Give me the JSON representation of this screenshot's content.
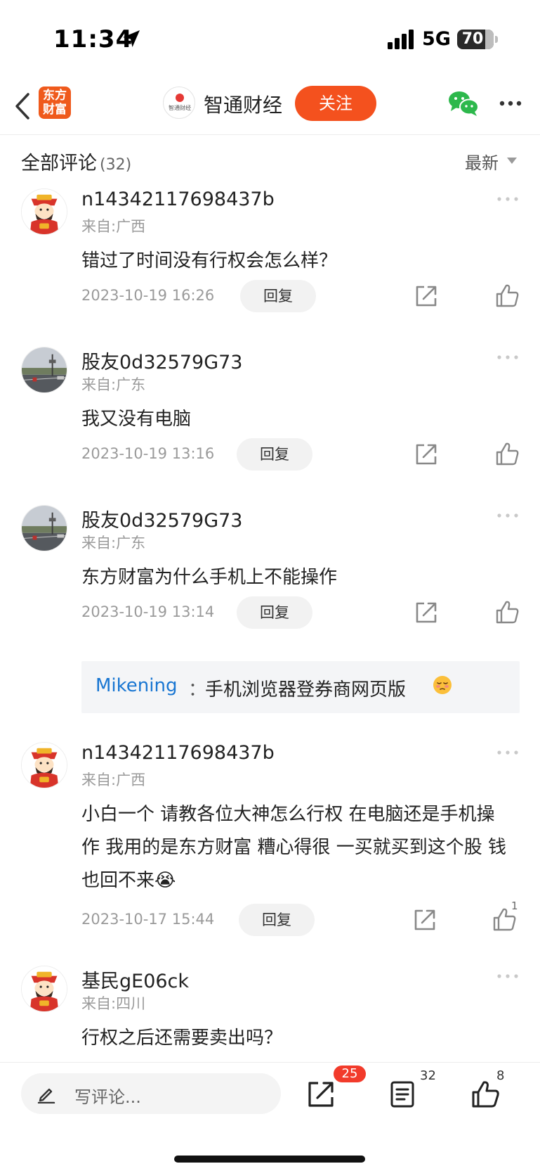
{
  "status_bar": {
    "time": "11:34",
    "network": "5G",
    "battery": "70",
    "icons": [
      "location-arrow-icon",
      "signal-bars-icon",
      "battery-icon"
    ]
  },
  "header": {
    "app_logo": "东方\n财富",
    "author_avatar_text": "智通财经",
    "author_name": "智通财经",
    "follow_label": "关注",
    "icons": [
      "back-chevron-icon",
      "wechat-icon",
      "more-horizontal-icon"
    ],
    "colors": {
      "brand": "#EF5A1C",
      "follow_button": "#F4511E"
    }
  },
  "comments_header": {
    "title": "全部评论",
    "count": "(32)",
    "sort_label": "最新"
  },
  "comments": [
    {
      "user": "n14342117698437b",
      "from": "来自:广西",
      "text": "错过了时间没有行权会怎么样？",
      "date": "2023-10-19 16:26",
      "reply_label": "回复",
      "likes": "",
      "avatar": "god-of-wealth-avatar"
    },
    {
      "user": "股友0d32579G73",
      "from": "来自:广东",
      "text": "我又没有电脑",
      "date": "2023-10-19 13:16",
      "reply_label": "回复",
      "likes": "",
      "avatar": "street-photo-avatar"
    },
    {
      "user": "股友0d32579G73",
      "from": "来自:广东",
      "text": "东方财富为什么手机上不能操作",
      "date": "2023-10-19 13:14",
      "reply_label": "回复",
      "likes": "",
      "avatar": "street-photo-avatar",
      "sub_reply": {
        "user": "Mikening",
        "colon": "：",
        "text": "手机浏览器登券商网页版"
      }
    },
    {
      "user": "n14342117698437b",
      "from": "来自:广西",
      "text": "小白一个 请教各位大神怎么行权 在电脑还是手机操作 我用的是东方财富 糟心得很 一买就买到这个股 钱也回不来😭",
      "date": "2023-10-17 15:44",
      "reply_label": "回复",
      "likes": "1",
      "avatar": "god-of-wealth-avatar"
    },
    {
      "user": "基民gE06ck",
      "from": "来自:四川",
      "text": "行权之后还需要卖出吗？",
      "avatar": "god-of-wealth-avatar"
    }
  ],
  "bottom_bar": {
    "compose_placeholder": "写评论...",
    "share_badge": "25",
    "comment_count": "32",
    "like_count": "8",
    "icons": [
      "pen-icon",
      "share-icon",
      "comment-list-icon",
      "thumbs-up-icon"
    ]
  }
}
